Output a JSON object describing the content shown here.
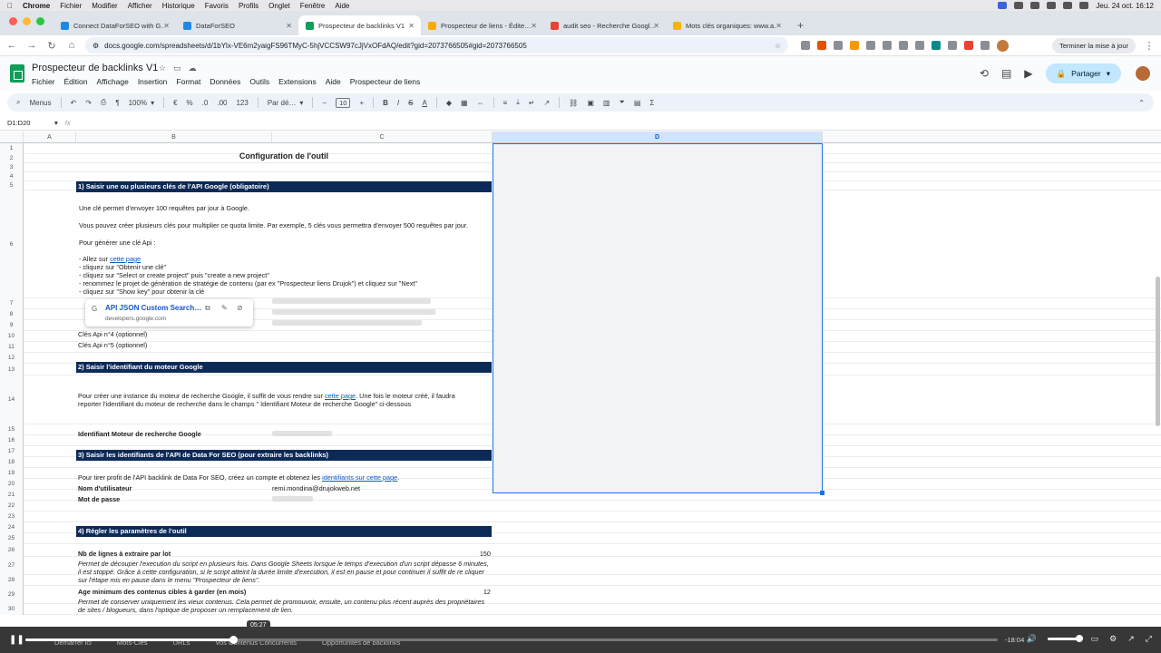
{
  "mac_menu": {
    "items": [
      "Chrome",
      "Fichier",
      "Modifier",
      "Afficher",
      "Historique",
      "Favoris",
      "Profils",
      "Onglet",
      "Fenêtre",
      "Aide"
    ],
    "datetime": "Jeu. 24 oct.  16:12"
  },
  "tabs": [
    {
      "label": "Connect DataForSEO with G…",
      "color": "#1e88e5",
      "active": false
    },
    {
      "label": "DataForSEO",
      "color": "#1e88e5",
      "active": false
    },
    {
      "label": "Prospecteur de backlinks V1",
      "color": "#0f9d58",
      "active": true
    },
    {
      "label": "Prospecteur de liens - Édite…",
      "color": "#f9ab00",
      "active": false
    },
    {
      "label": "audit seo - Recherche Googl…",
      "color": "#ea4335",
      "active": false
    },
    {
      "label": "Mots clés organiques: www.a…",
      "color": "#f4b400",
      "active": false
    }
  ],
  "address": {
    "url": "docs.google.com/spreadsheets/d/1bYlx-VE6m2yaigFS96TMyC-5hjVCCSW97cJjVxOFdAQ/edit?gid=2073766505#gid=2073766505",
    "update_label": "Terminer la mise à jour"
  },
  "doc": {
    "title": "Prospecteur de backlinks V1",
    "menu": [
      "Fichier",
      "Édition",
      "Affichage",
      "Insertion",
      "Format",
      "Données",
      "Outils",
      "Extensions",
      "Aide",
      "Prospecteur de liens"
    ],
    "share_label": "Partager"
  },
  "toolbar": {
    "menus": "Menus",
    "zoom": "100%",
    "currency": "€",
    "percent": "%",
    "dec_less": ".0",
    "dec_more": ".00",
    "num_format": "123",
    "font": "Par dé…",
    "font_size": "10"
  },
  "formula": {
    "namebox": "D1:D20",
    "fx": "fx"
  },
  "columns": [
    "A",
    "B",
    "C",
    "D"
  ],
  "rows": [
    "1",
    "2",
    "3",
    "4",
    "5",
    "6",
    "7",
    "8",
    "9",
    "10",
    "11",
    "12",
    "13",
    "14",
    "15",
    "16",
    "17",
    "18",
    "19",
    "20",
    "21",
    "22",
    "23",
    "24",
    "25",
    "26",
    "27",
    "28",
    "29",
    "30"
  ],
  "sheet": {
    "title": "Configuration de l'outil",
    "s1": "1) Saisir une ou plusieurs clés de l'API Google (obligatoire)",
    "s1_text": [
      "Une clé permet d'envoyer 100 requêtes par jour à Google.",
      "Vous pouvez créer plusieurs clés pour multiplier ce quota limite. Par exemple, 5 clés vous permettra d'envoyer 500 requêtes par jour.",
      "Pour générer une clé Api :",
      "- Allez sur ",
      "cette page",
      "- cliquez sur \"Obtenir une clé\"",
      "- cliquez sur \"Select or create project\" puis \"create a new project\"",
      "- renommez le projet de génération de stratégie de contenu (par ex \"Prospecteur liens Drujok\") et cliquez sur \"Next\"",
      "- cliquez sur \"Show key\" pour obtenir la clé"
    ],
    "key4": "Clés Api n°4 (optionnel)",
    "key5": "Clés Api n°5 (optionnel)",
    "s2": "2) Saisir l'identifiant du moteur Google",
    "s2_text_a": "Pour créer une instance du moteur de recherche Google, il suffit de vous rendre sur ",
    "s2_link": "cette page",
    "s2_text_b": ". Une fois le moteur créé, il faudra",
    "s2_text_c": "reporter l'identifiant du moteur de recherche dans le champs \" Identifiant Moteur de recherche Google\" ci-dessous",
    "engine_label": "Identifiant Moteur de recherche Google",
    "s3": "3) Saisir les identifiants de l'API de Data For SEO (pour extraire les backlinks)",
    "s3_text": "Pour tirer profit de l'API backlink de Data For SEO, créez un compte et obtenez les ",
    "s3_link": "identifiants sur cette page",
    "user_label": "Nom d'utilisateur",
    "user_value": "remi.mondina@drujokweb.net",
    "pass_label": "Mot de passe",
    "s4": "4) Régler les paramètres de l'outil",
    "lines_label": "Nb de lignes à extraire par lot",
    "lines_value": "150",
    "lines_desc": "Permet de découper l'execution du script en plusieurs fois. Dans Google Sheets lorsque le temps d'execution d'un script dépasse 6 minutes, il est stoppé. Grâce à cette configuration, si le script atteint la durée limite d'execution, il est en pause et pour continuer il suffit de re cliquer sur l'étape mis en pause dans le menu \"Prospecteur de liens\".",
    "age_label": "Age minimum des contenus cibles à garder (en mois)",
    "age_value": "12",
    "age_desc": "Permet de conserver uniquement les vieux contenus. Cela permet de promouvoir, ensuite, un contenu plus récent auprès des propriétaires de sites / blogueurs, dans l'optique de proposer un remplacement de lien."
  },
  "popup": {
    "title": "API JSON Custom Search…",
    "domain": "developers.google.com"
  },
  "video": {
    "tooltip_time": "05:27",
    "remaining": "-18:04",
    "progress_fraction": 0.215,
    "sheet_tabs": [
      "Démarrer ici",
      "Mots-Clés",
      "URLs",
      "Vos Contenus Concurrents",
      "Opportunités de backlinks"
    ]
  }
}
